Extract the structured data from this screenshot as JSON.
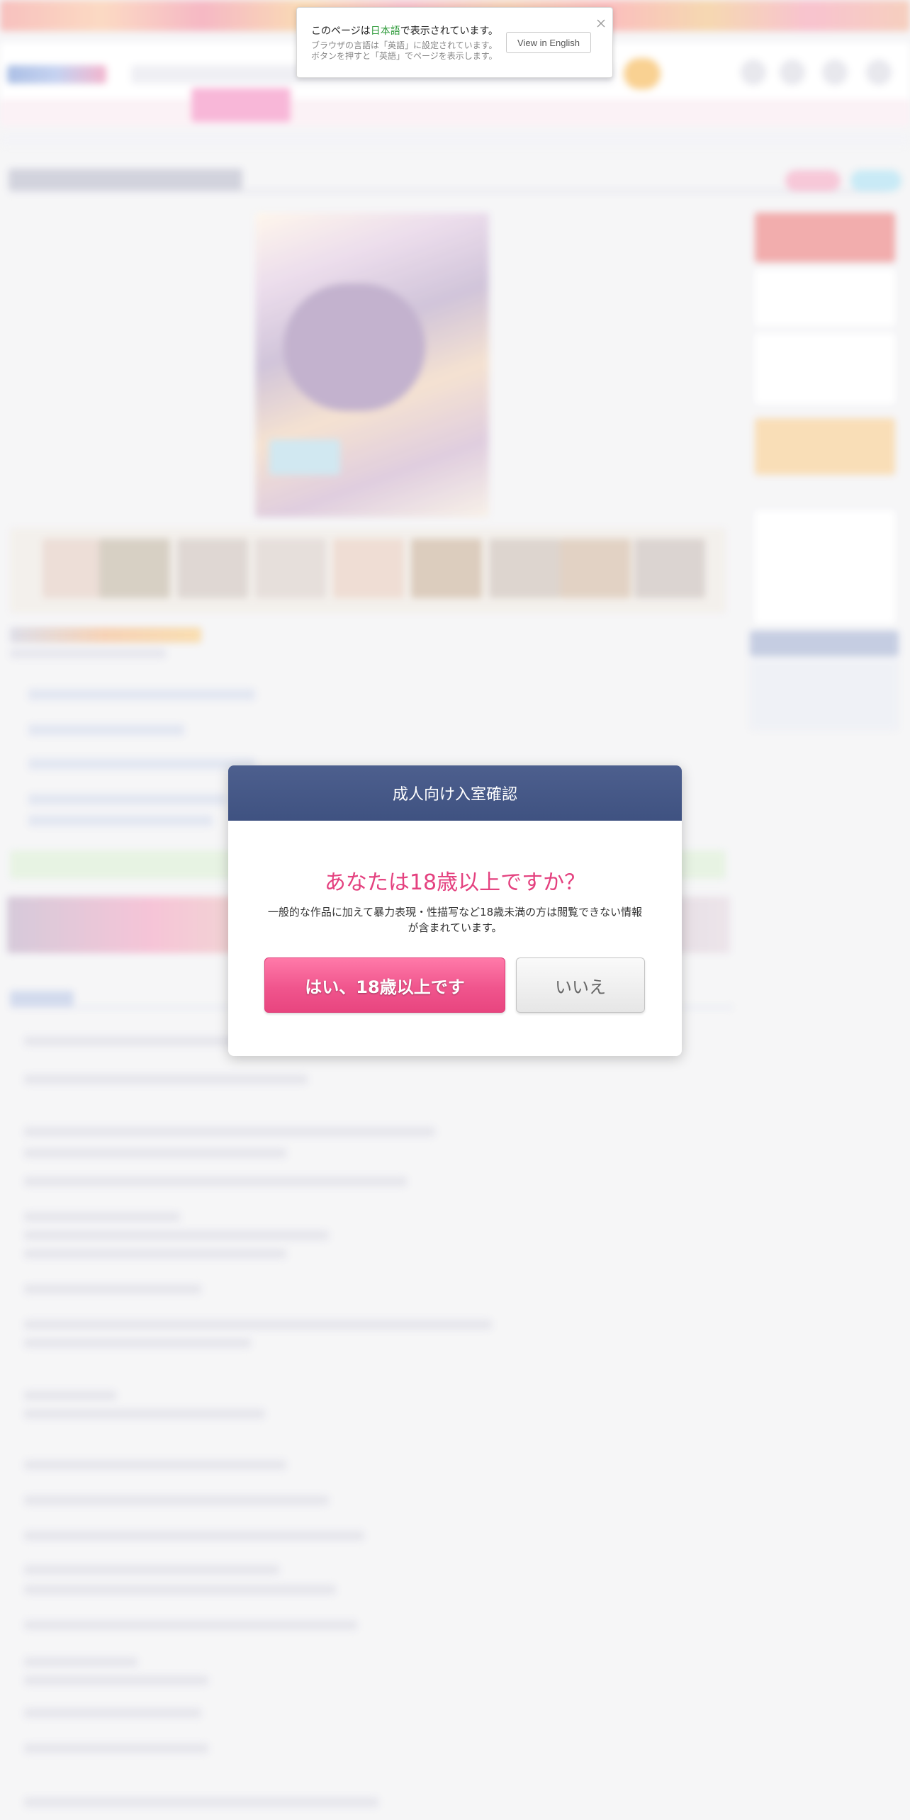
{
  "language_bar": {
    "message_prefix": "このページは",
    "language_name": "日本語",
    "message_suffix": "で表示されています。",
    "sub_line1": "ブラウザの言語は「英語」に設定されています。",
    "sub_line2": "ボタンを押すと「英語」でページを表示します。",
    "view_in_english_label": "View in English",
    "close_icon": "close-icon"
  },
  "age_modal": {
    "title": "成人向け入室確認",
    "question": "あなたは18歳以上ですか？",
    "note": "一般的な作品に加えて暴力表現・性描写など18歳未満の方は閲覧できない情報が含まれています。",
    "yes_label": "はい、18歳以上です",
    "no_label": "いいえ"
  },
  "colors": {
    "modal_header": "#45588a",
    "accent_pink": "#e4417f",
    "yes_button": "#f0558d",
    "language_highlight": "#2e9a3a"
  }
}
